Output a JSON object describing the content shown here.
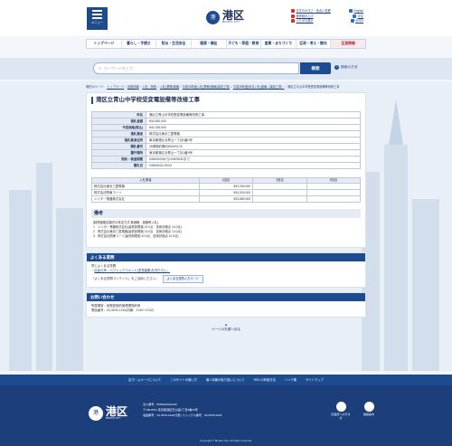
{
  "header": {
    "menu_label": "メニュー",
    "logo_main": "港区",
    "logo_sub": "MINATO CITY",
    "logo_seal": "港",
    "util_links": [
      "文字の大きさ・色合い変更",
      "English",
      "音声読み上げ",
      "中文",
      "ふりがな表示",
      "한국어"
    ]
  },
  "gnav": [
    "トップページ",
    "暮らし・手続き",
    "防災・生活安全",
    "健康・福祉",
    "子ども・家庭・教育",
    "産業・まちづくり",
    "区政・考え・観光",
    "区長情報"
  ],
  "search": {
    "placeholder": "キーワードを入力",
    "button": "検索",
    "help": "検索の方法"
  },
  "breadcrumb": [
    "現在のページ",
    "トップページ",
    "区政情報",
    "入札・契約",
    "入札(業務)実績",
    "平成28年度入札(業務)実績(建設工事)",
    "平成28年度(年月入札)実績（建設工事）",
    "港区立青山中学校受変電設備等改修工事"
  ],
  "title": "港区立青山中学校受変電設備等改修工事",
  "info": [
    [
      "件名",
      "港区立青山中学校受変電設備等改修工事"
    ],
    [
      "落札金額",
      "¥34,830,000"
    ],
    [
      "予定価格(税込)",
      "¥41,025,000"
    ],
    [
      "落札業者",
      "株式会社東京三菱電機"
    ],
    [
      "落札業者住所",
      "東京都港区北青山一丁目0番0号"
    ],
    [
      "開札番号",
      "28港契約第B000000176"
    ],
    [
      "履行場所",
      "東京都港区北青山一丁目1番9号"
    ],
    [
      "契約・検査期間",
      "H28/05/25からH28/09/30まで"
    ],
    [
      "開札日",
      "H28/05/24 09:00"
    ]
  ],
  "bid_headers": [
    "入札業者",
    "1回目",
    "2回目",
    "3回目"
  ],
  "bids": [
    [
      "株式会社東京三菱電機",
      "¥32,250,000",
      "",
      ""
    ],
    [
      "株式会社関東コーリ",
      "¥34,000,000",
      "",
      ""
    ],
    [
      "シンター電器株式会社",
      "¥33,880,000",
      "",
      ""
    ]
  ],
  "notes_title": "備考",
  "notes": [
    "[制限価格定額式の特定方式 無価格…価格率入札]",
    "1　シンター電器株式会社(最低制限価 13.0点　技術評価点 10.0点)",
    "2　株式会社東京三菱電機(最低制限価 13.0点　技術評価点 13.0点)",
    "3　株式会社関東コーリ(最低制限価 13.0点　技術評価点 10.5点)"
  ],
  "faq": {
    "title": "よくある質問",
    "line1": "同じよくある質問",
    "link": "区民の声・パブリックコメント(意見募集)を知りたい。",
    "line2": "「よくある質問コンテンツ」をご活用ください。",
    "button": "よくある質問入力ページ"
  },
  "contact": {
    "title": "お問い合わせ",
    "line1": "所属課室：総務部契約管理課契約係",
    "line2": "電話番号：03-3578-2140(内線：2140～2142)"
  },
  "pagetop": "ページの先頭へ戻る",
  "footer_nav": [
    "区ホームページについて",
    "このサイトの使い方",
    "個人情報の取り扱いについて",
    "RSS の利用方法",
    "リンク集",
    "サイトマップ"
  ],
  "footer": {
    "logo_main": "港区",
    "logo_sub": "MINATO CITY",
    "logo_seal": "港",
    "corp_no": "法人番号：8000020131032",
    "address": "〒105-8511 東京都港区芝公園1丁目5番25号",
    "tel": "電話番号：03-3578-2111(代表)  ファックス番号：03-3578-2034",
    "btn1": "区役所への行き方",
    "btn2": "組織案内",
    "copyright": "Copyright © Minato City. All rights reserved."
  }
}
